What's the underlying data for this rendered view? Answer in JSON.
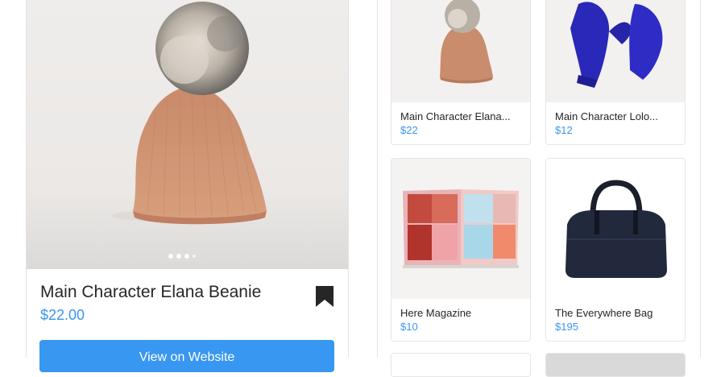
{
  "featured": {
    "title": "Main Character Elana Beanie",
    "price": "$22.00",
    "cta_label": "View on Website",
    "carousel_pages": 4,
    "carousel_active": 1
  },
  "grid": [
    {
      "name": "Main Character Elana...",
      "price": "$22"
    },
    {
      "name": "Main Character Lolo...",
      "price": "$12"
    },
    {
      "name": "Here Magazine",
      "price": "$10"
    },
    {
      "name": "The Everywhere Bag",
      "price": "$195"
    }
  ],
  "colors": {
    "accent": "#3897f0",
    "text": "#262626"
  }
}
